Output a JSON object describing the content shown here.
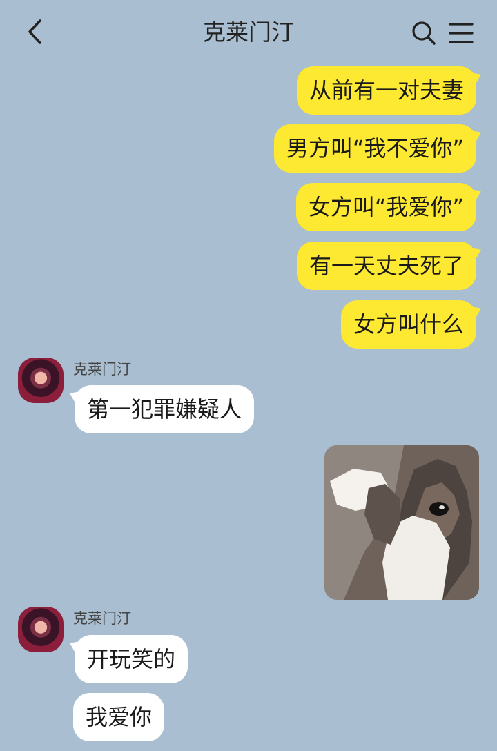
{
  "header": {
    "title": "克莱门汀",
    "back_icon": "chevron-left-icon",
    "search_icon": "search-icon",
    "menu_icon": "menu-icon"
  },
  "messages": [
    {
      "side": "sent",
      "text": "从前有一对夫妻"
    },
    {
      "side": "sent",
      "text": "男方叫“我不爱你”"
    },
    {
      "side": "sent",
      "text": "女方叫“我爱你”"
    },
    {
      "side": "sent",
      "text": "有一天丈夫死了"
    },
    {
      "side": "sent",
      "text": "女方叫什么"
    },
    {
      "side": "received",
      "sender": "克莱门汀",
      "text": "第一犯罪嫌疑人"
    },
    {
      "side": "sent",
      "type": "image",
      "content": "cat-photo"
    },
    {
      "side": "received",
      "sender": "克莱门汀",
      "text": "开玩笑的"
    },
    {
      "side": "received",
      "text": "我爱你"
    }
  ],
  "colors": {
    "background": "#a9bfd1",
    "sent_bubble": "#fde832",
    "received_bubble": "#ffffff"
  }
}
